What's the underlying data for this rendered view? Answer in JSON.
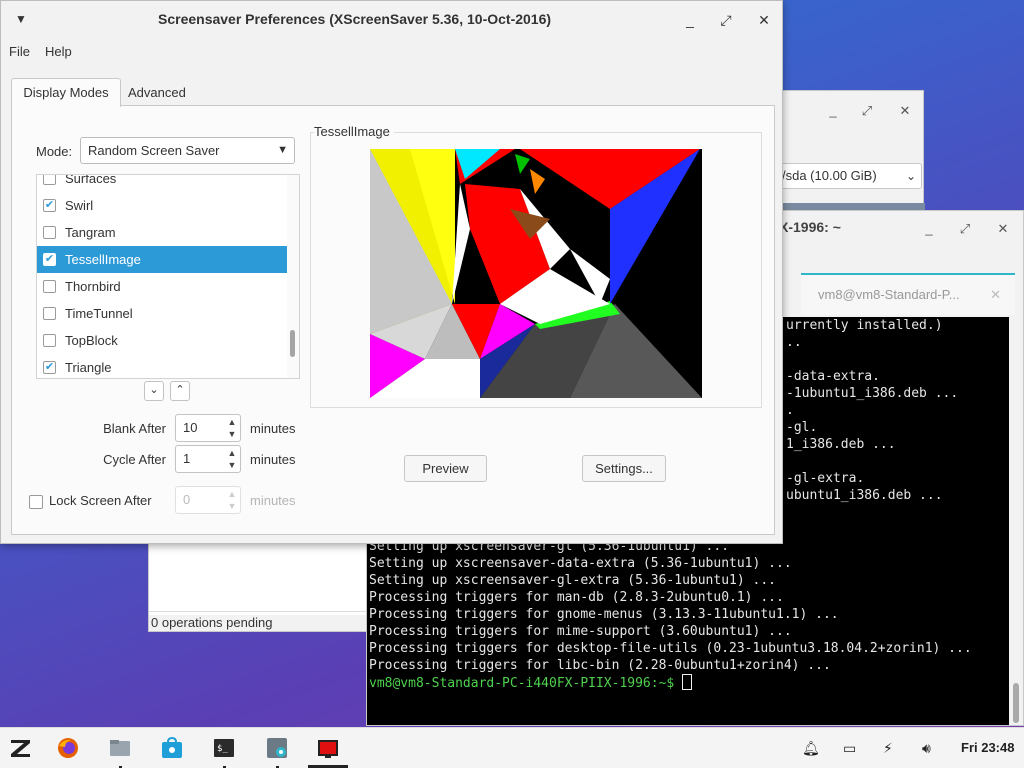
{
  "screensaver_window": {
    "title": "Screensaver Preferences  (XScreenSaver 5.36, 10-Oct-2016)",
    "menu": [
      "File",
      "Help"
    ],
    "tabs": [
      "Display Modes",
      "Advanced"
    ],
    "mode_label": "Mode:",
    "mode_value": "Random Screen Saver",
    "savers": [
      {
        "name": "Surfaces",
        "checked": false
      },
      {
        "name": "Swirl",
        "checked": true
      },
      {
        "name": "Tangram",
        "checked": false
      },
      {
        "name": "TessellImage",
        "checked": true,
        "selected": true
      },
      {
        "name": "Thornbird",
        "checked": false
      },
      {
        "name": "TimeTunnel",
        "checked": false
      },
      {
        "name": "TopBlock",
        "checked": false
      },
      {
        "name": "Triangle",
        "checked": true
      }
    ],
    "blank_after_label": "Blank After",
    "blank_after_value": "10",
    "cycle_after_label": "Cycle After",
    "cycle_after_value": "1",
    "lock_label": "Lock Screen After",
    "lock_value": "0",
    "minutes": "minutes",
    "preview_title": "TessellImage",
    "preview_button": "Preview",
    "settings_button": "Settings..."
  },
  "background_window": {
    "device": "/sda   (10.00 GiB)",
    "status": "0 operations pending"
  },
  "terminal": {
    "title": "X-1996: ~",
    "tab_label": "vm8@vm8-Standard-P...",
    "lines": [
      "urrently installed.)",
      "..",
      "",
      "-data-extra.",
      "-1ubuntu1_i386.deb ...",
      ".",
      "-gl.",
      "1_i386.deb ...",
      "",
      "-gl-extra.",
      "ubuntu1_i386.deb ...",
      "",
      "",
      "Setting up xscreensaver-gl (5.36-1ubuntu1) ...",
      "Setting up xscreensaver-data-extra (5.36-1ubuntu1) ...",
      "Setting up xscreensaver-gl-extra (5.36-1ubuntu1) ...",
      "Processing triggers for man-db (2.8.3-2ubuntu0.1) ...",
      "Processing triggers for gnome-menus (3.13.3-11ubuntu1.1) ...",
      "Processing triggers for mime-support (3.60ubuntu1) ...",
      "Processing triggers for desktop-file-utils (0.23-1ubuntu3.18.04.2+zorin1) ...",
      "Processing triggers for libc-bin (2.28-0ubuntu1+zorin4) ..."
    ],
    "prompt": "vm8@vm8-Standard-PC-i440FX-PIIX-1996:~$ "
  },
  "taskbar": {
    "clock": "Fri 23:48",
    "apps": [
      "zorin-menu-icon",
      "firefox-icon",
      "files-icon",
      "software-store-icon",
      "terminal-icon",
      "settings-icon",
      "screensaver-icon"
    ]
  },
  "colors": {
    "selection": "#2d9ad8",
    "prompt_green": "#4fd14f",
    "terminal_tab_accent": "#2fb6c8"
  }
}
